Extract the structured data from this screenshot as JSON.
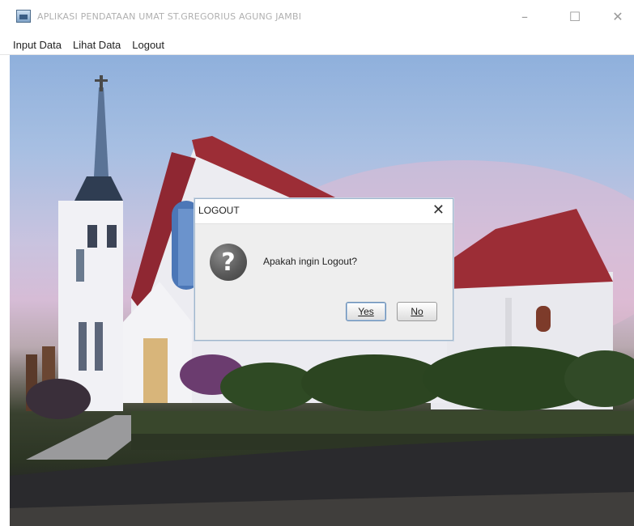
{
  "window": {
    "title": "APLIKASI PENDATAAN UMAT ST.GREGORIUS AGUNG JAMBI",
    "controls": {
      "minimize": "–",
      "maximize": "☐",
      "close": "✕"
    }
  },
  "menubar": {
    "items": [
      {
        "label": "Input Data"
      },
      {
        "label": "Lihat Data"
      },
      {
        "label": "Logout"
      }
    ]
  },
  "background": {
    "subject": "church-photo"
  },
  "dialog": {
    "title": "LOGOUT",
    "close_glyph": "✕",
    "icon": "question-icon",
    "icon_glyph": "?",
    "message": "Apakah ingin Logout?",
    "buttons": {
      "yes": "Yes",
      "no": "No"
    }
  },
  "colors": {
    "titlebar": "#ffffff",
    "dialog_bg": "#eeeeee",
    "dialog_border": "#9fb5cc",
    "roof_red": "#9c2d36"
  }
}
